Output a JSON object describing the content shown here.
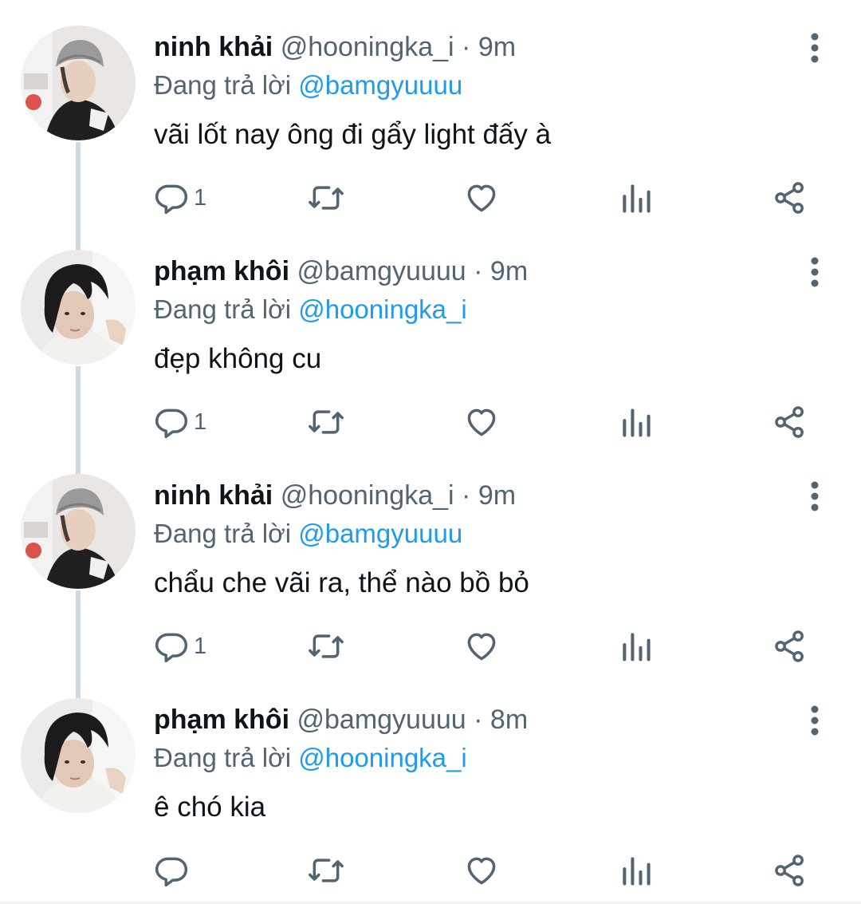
{
  "tweets": [
    {
      "name": "ninh khải",
      "handle": "@hooningka_i",
      "separator": "·",
      "time": "9m",
      "replying_prefix": "Đang trả lời",
      "replying_to": "@bamgyuuuu",
      "text": "vãi lốt nay ông đi gẩy light đấy à",
      "reply_count": "1",
      "avatar_icon": "avatar-beanie"
    },
    {
      "name": "phạm khôi",
      "handle": "@bamgyuuuu",
      "separator": "·",
      "time": "9m",
      "replying_prefix": "Đang trả lời",
      "replying_to": "@hooningka_i",
      "text": "đẹp không cu",
      "reply_count": "1",
      "avatar_icon": "avatar-dark-hair"
    },
    {
      "name": "ninh khải",
      "handle": "@hooningka_i",
      "separator": "·",
      "time": "9m",
      "replying_prefix": "Đang trả lời",
      "replying_to": "@bamgyuuuu",
      "text": "chẩu che vãi ra, thể nào bồ bỏ",
      "reply_count": "1",
      "avatar_icon": "avatar-beanie"
    },
    {
      "name": "phạm khôi",
      "handle": "@bamgyuuuu",
      "separator": "·",
      "time": "8m",
      "replying_prefix": "Đang trả lời",
      "replying_to": "@hooningka_i",
      "text": "ê chó kia",
      "reply_count": "",
      "avatar_icon": "avatar-dark-hair"
    }
  ],
  "icons": {
    "reply": "reply-icon",
    "retweet": "retweet-icon",
    "like": "heart-icon",
    "views": "views-icon",
    "share": "share-icon",
    "more": "more-vertical-icon"
  },
  "colors": {
    "text_primary": "#0f1419",
    "text_secondary": "#536471",
    "mention": "#1d9bf0",
    "thread_line": "#cfd9de"
  }
}
